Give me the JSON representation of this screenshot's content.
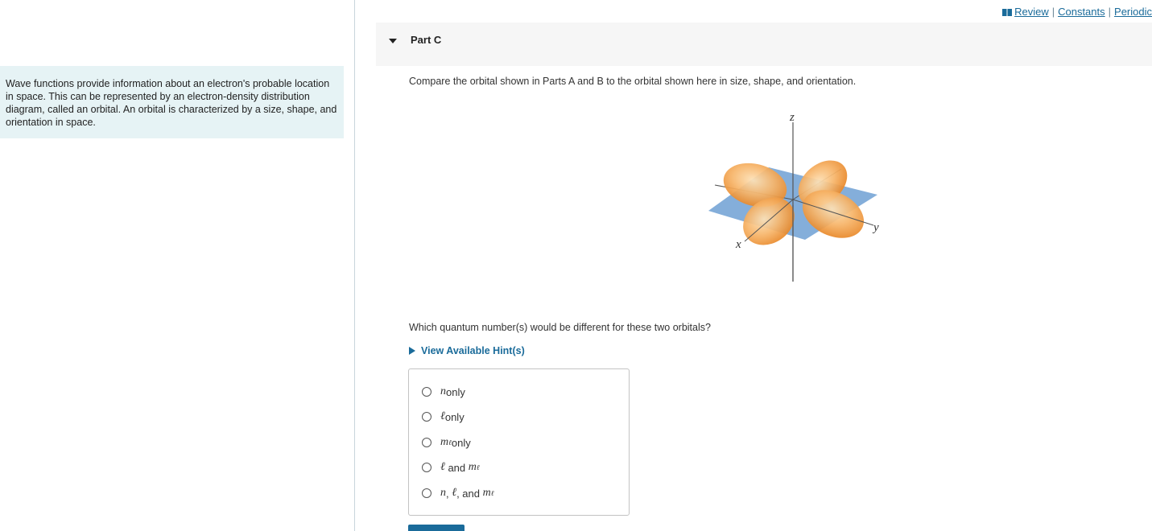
{
  "intro": {
    "text": "Wave functions provide information about an electron's probable location in space. This can be represented by an electron-density distribution diagram, called an orbital.  An orbital is characterized by a size, shape, and orientation in space."
  },
  "top_links": {
    "review": "Review",
    "constants": "Constants",
    "periodic": "Periodic",
    "separator": "|"
  },
  "part": {
    "title": "Part C"
  },
  "question": {
    "text": "Compare the orbital shown in Parts A and B to the orbital shown here  in size, shape, and orientation.",
    "sub_question": "Which quantum number(s) would be different for these two orbitals?",
    "hint_label": "View Available Hint(s)"
  },
  "figure": {
    "z_label": "z",
    "x_label": "x",
    "y_label": "y"
  },
  "choices": {
    "c1": {
      "n": "n",
      "rest": " only"
    },
    "c2": {
      "l": "ℓ",
      "rest": " only"
    },
    "c3": {
      "m": "m",
      "msub": "ℓ",
      "rest": " only"
    },
    "c4": {
      "l": "ℓ",
      "and": " and ",
      "m": "m",
      "msub": "ℓ"
    },
    "c5": {
      "n": "n",
      "comma1": ", ",
      "l": "ℓ",
      "and": ", and ",
      "m": "m",
      "msub": "ℓ"
    }
  },
  "colors": {
    "accent_link": "#1a6b9a",
    "intro_bg": "#e6f3f5",
    "lobe": "#f5a955",
    "plane": "#6fa0d4"
  }
}
